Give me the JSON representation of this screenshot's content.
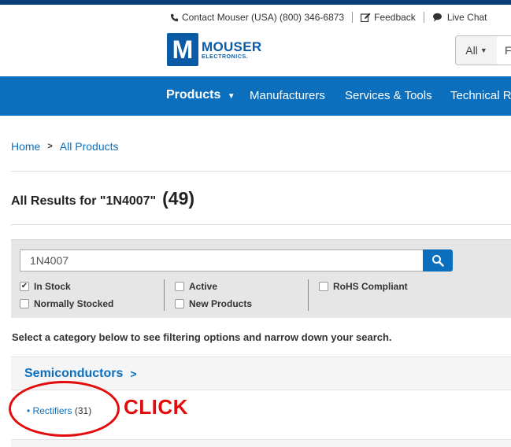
{
  "utility": {
    "contact": "Contact Mouser (USA) (800) 346-6873",
    "feedback": "Feedback",
    "chat": "Live Chat"
  },
  "logo": {
    "letter": "M",
    "brand": "MOUSER",
    "sub": "ELECTRONICS."
  },
  "header_search": {
    "scope": "All",
    "value": "F"
  },
  "nav": {
    "products": "Products",
    "manufacturers": "Manufacturers",
    "services": "Services & Tools",
    "technical": "Technical Re"
  },
  "breadcrumb": {
    "home": "Home",
    "all_products": "All Products"
  },
  "results": {
    "label": "All Results for \"1N4007\"",
    "count": "(49)"
  },
  "filters": {
    "search_value": "1N4007",
    "in_stock": "In Stock",
    "in_stock_checked": true,
    "normally_stocked": "Normally Stocked",
    "active": "Active",
    "new_products": "New Products",
    "rohs": "RoHS Compliant"
  },
  "instructions": "Select a category below to see filtering options and narrow down your search.",
  "category": {
    "name": "Semiconductors",
    "subcategory": "• Rectifiers",
    "subcategory_count": "(31)"
  },
  "annotation": {
    "text": "CLICK",
    "color": "#e30b0b"
  },
  "colors": {
    "nav_blue": "#0b6fbd",
    "link_blue": "#0b6fbd",
    "top_stripe": "#0a3f7a"
  }
}
